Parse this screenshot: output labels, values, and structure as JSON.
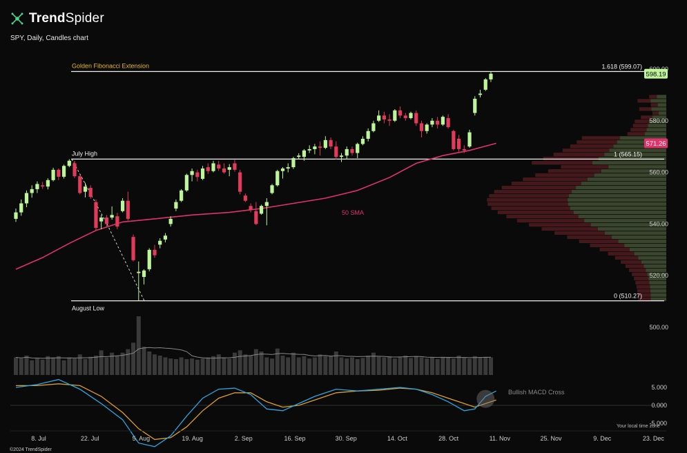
{
  "brand": {
    "name_bold": "Trend",
    "name_rest": "Spider"
  },
  "subtitle": "SPY, Daily, Candles chart",
  "copyright": "©2024 TrendSpider",
  "timezone_label": "Your local time zone",
  "colors": {
    "bg": "#0a0a0a",
    "up": "#bff59a",
    "down": "#e23a5a",
    "sma": "#e0336b",
    "macd": "#2aa8e6",
    "signal": "#e0a02a",
    "fib_label": "#e8b92c",
    "volume": "#3a3a3a"
  },
  "chart_data": {
    "type": "candlestick",
    "symbol": "SPY",
    "interval": "Daily",
    "price_axis": {
      "ticks": [
        "600.00",
        "580.00",
        "560.00",
        "540.00",
        "520.00",
        "500.00"
      ]
    },
    "x_axis": {
      "ticks": [
        "8. Jul",
        "22. Jul",
        "5. Aug",
        "19. Aug",
        "2. Sep",
        "16. Sep",
        "30. Sep",
        "14. Oct",
        "28. Oct",
        "11. Nov",
        "25. Nov",
        "9. Dec",
        "23. Dec"
      ]
    },
    "last_price": "598.19",
    "sma_value": "571.26",
    "sma_label": "50 SMA",
    "levels": [
      {
        "name": "Golden Fibonacci Extension",
        "value": 599.07,
        "tag": "1.618 (599.07)"
      },
      {
        "name": "July High",
        "value": 565.15,
        "tag": "1 (565.15)"
      },
      {
        "name": "August Low",
        "value": 510.27,
        "tag": "0 (510.27)"
      }
    ],
    "candles": [
      [
        542.0,
        546.0,
        540.8,
        544.5
      ],
      [
        544.5,
        549.5,
        543.2,
        548.0
      ],
      [
        548.0,
        553.0,
        546.5,
        552.0
      ],
      [
        552.0,
        555.0,
        550.2,
        553.5
      ],
      [
        553.5,
        556.5,
        552.0,
        555.5
      ],
      [
        555.0,
        556.3,
        553.6,
        554.5
      ],
      [
        554.5,
        557.7,
        553.4,
        557.0
      ],
      [
        557.0,
        561.8,
        556.5,
        561.0
      ],
      [
        561.0,
        561.5,
        557.0,
        558.3
      ],
      [
        558.3,
        563.0,
        557.6,
        562.5
      ],
      [
        562.5,
        565.1,
        562.0,
        564.5
      ],
      [
        563.5,
        564.5,
        557.8,
        558.5
      ],
      [
        558.5,
        559.0,
        551.5,
        552.0
      ],
      [
        552.5,
        556.0,
        550.3,
        554.5
      ],
      [
        554.0,
        555.0,
        549.8,
        550.5
      ],
      [
        548.5,
        549.5,
        537.5,
        538.5
      ],
      [
        541.0,
        543.5,
        538.0,
        542.5
      ],
      [
        542.5,
        543.5,
        538.6,
        540.0
      ],
      [
        542.5,
        546.8,
        541.7,
        543.5
      ],
      [
        543.0,
        544.3,
        538.0,
        539.0
      ],
      [
        545.0,
        550.0,
        544.5,
        549.0
      ],
      [
        549.0,
        552.5,
        541.3,
        542.0
      ],
      [
        535.0,
        536.0,
        525.5,
        526.0
      ],
      [
        521.0,
        525.5,
        510.3,
        521.5
      ],
      [
        519.5,
        522.5,
        516.6,
        522.0
      ],
      [
        522.5,
        530.6,
        521.7,
        530.0
      ],
      [
        530.0,
        531.9,
        526.9,
        527.9
      ],
      [
        532.0,
        534.5,
        530.6,
        533.5
      ],
      [
        534.0,
        536.5,
        532.9,
        535.5
      ],
      [
        540.0,
        543.0,
        539.0,
        542.0
      ],
      [
        546.0,
        549.5,
        545.0,
        548.5
      ],
      [
        549.0,
        553.5,
        548.5,
        553.0
      ],
      [
        553.0,
        559.5,
        552.5,
        559.0
      ],
      [
        559.0,
        561.5,
        556.5,
        560.5
      ],
      [
        560.0,
        561.0,
        556.5,
        558.2
      ],
      [
        557.5,
        562.5,
        557.0,
        561.5
      ],
      [
        562.0,
        563.5,
        559.4,
        560.5
      ],
      [
        560.5,
        564.5,
        560.0,
        563.5
      ],
      [
        563.0,
        564.5,
        560.6,
        561.5
      ],
      [
        561.5,
        563.5,
        559.5,
        560.0
      ],
      [
        561.0,
        563.2,
        558.5,
        562.0
      ],
      [
        563.5,
        564.8,
        560.3,
        561.0
      ],
      [
        560.0,
        561.0,
        551.5,
        552.5
      ],
      [
        551.0,
        551.8,
        548.5,
        549.0
      ],
      [
        547.0,
        548.0,
        544.5,
        545.5
      ],
      [
        545.0,
        548.5,
        539.6,
        540.0
      ],
      [
        544.0,
        547.5,
        543.6,
        547.0
      ],
      [
        547.0,
        550.0,
        539.5,
        548.5
      ],
      [
        552.0,
        555.5,
        551.5,
        555.0
      ],
      [
        555.0,
        561.0,
        554.5,
        560.5
      ],
      [
        560.5,
        562.0,
        557.6,
        561.5
      ],
      [
        561.5,
        563.5,
        560.0,
        562.0
      ],
      [
        562.0,
        566.0,
        561.3,
        565.5
      ],
      [
        566.0,
        567.4,
        565.0,
        566.5
      ],
      [
        566.0,
        569.0,
        564.5,
        568.5
      ],
      [
        568.5,
        570.5,
        567.5,
        569.0
      ],
      [
        569.0,
        571.0,
        567.0,
        570.0
      ],
      [
        570.0,
        572.0,
        566.5,
        569.5
      ],
      [
        569.5,
        574.0,
        569.0,
        572.5
      ],
      [
        572.5,
        573.5,
        569.0,
        570.0
      ],
      [
        570.0,
        572.0,
        565.0,
        566.0
      ],
      [
        566.0,
        567.5,
        564.0,
        566.5
      ],
      [
        566.5,
        570.0,
        565.0,
        569.0
      ],
      [
        569.0,
        570.0,
        566.5,
        567.5
      ],
      [
        567.5,
        571.5,
        565.5,
        571.0
      ],
      [
        571.0,
        574.0,
        570.5,
        573.0
      ],
      [
        573.0,
        577.0,
        572.0,
        576.0
      ],
      [
        576.0,
        580.0,
        575.5,
        579.0
      ],
      [
        580.0,
        584.0,
        579.5,
        582.0
      ],
      [
        582.0,
        583.5,
        579.0,
        580.5
      ],
      [
        580.5,
        582.5,
        578.0,
        580.0
      ],
      [
        580.0,
        584.5,
        579.5,
        584.0
      ],
      [
        584.0,
        585.5,
        581.0,
        582.0
      ],
      [
        582.0,
        583.0,
        580.0,
        581.0
      ],
      [
        581.0,
        583.5,
        580.5,
        583.0
      ],
      [
        583.0,
        584.0,
        578.0,
        579.0
      ],
      [
        579.0,
        580.0,
        573.5,
        576.0
      ],
      [
        576.0,
        579.0,
        575.0,
        578.5
      ],
      [
        578.5,
        581.0,
        577.5,
        580.0
      ],
      [
        580.0,
        581.5,
        577.0,
        578.5
      ],
      [
        578.5,
        582.0,
        578.0,
        581.5
      ],
      [
        581.0,
        582.5,
        577.0,
        577.5
      ],
      [
        576.0,
        576.5,
        568.5,
        569.0
      ],
      [
        573.0,
        574.5,
        568.0,
        569.0
      ],
      [
        569.0,
        570.5,
        567.5,
        568.5
      ],
      [
        570.0,
        576.5,
        569.5,
        575.5
      ],
      [
        583.0,
        589.5,
        582.0,
        588.5
      ],
      [
        590.0,
        592.0,
        589.0,
        590.5
      ],
      [
        592.0,
        596.5,
        591.5,
        596.0
      ],
      [
        596.0,
        599.1,
        595.0,
        598.2
      ]
    ],
    "sma": [
      [
        0,
        522.5
      ],
      [
        5,
        527.0
      ],
      [
        10,
        532.5
      ],
      [
        15,
        537.5
      ],
      [
        20,
        540.8
      ],
      [
        26,
        542.0
      ],
      [
        33,
        543.5
      ],
      [
        40,
        544.5
      ],
      [
        46,
        546.0
      ],
      [
        52,
        548.0
      ],
      [
        58,
        550.0
      ],
      [
        64,
        553.0
      ],
      [
        70,
        558.0
      ],
      [
        75,
        563.5
      ],
      [
        80,
        566.5
      ],
      [
        85,
        568.5
      ],
      [
        90,
        571.26
      ]
    ],
    "volume": [
      0.3,
      0.28,
      0.33,
      0.25,
      0.28,
      0.26,
      0.32,
      0.3,
      0.32,
      0.25,
      0.3,
      0.28,
      0.35,
      0.27,
      0.31,
      0.33,
      0.42,
      0.3,
      0.38,
      0.33,
      0.38,
      0.44,
      0.55,
      1.0,
      0.48,
      0.4,
      0.35,
      0.33,
      0.3,
      0.28,
      0.27,
      0.3,
      0.27,
      0.28,
      0.26,
      0.28,
      0.3,
      0.32,
      0.35,
      0.3,
      0.28,
      0.38,
      0.42,
      0.35,
      0.33,
      0.44,
      0.4,
      0.3,
      0.28,
      0.45,
      0.33,
      0.3,
      0.38,
      0.3,
      0.32,
      0.28,
      0.3,
      0.35,
      0.32,
      0.33,
      0.4,
      0.3,
      0.28,
      0.3,
      0.27,
      0.29,
      0.33,
      0.38,
      0.31,
      0.3,
      0.32,
      0.28,
      0.3,
      0.33,
      0.29,
      0.32,
      0.3,
      0.28,
      0.3,
      0.27,
      0.31,
      0.3,
      0.28,
      0.33,
      0.3,
      0.28,
      0.32,
      0.3,
      0.31,
      0.3
    ],
    "macd_axis": {
      "ticks": [
        "5.000",
        "0.000",
        "-5.000"
      ]
    },
    "macd_label": "Bullish MACD Cross",
    "macd": [
      [
        0,
        5.0
      ],
      [
        4,
        5.8
      ],
      [
        8,
        7.2
      ],
      [
        12,
        4.5
      ],
      [
        16,
        0.5
      ],
      [
        20,
        -4.0
      ],
      [
        23,
        -10.5
      ],
      [
        26,
        -11.5
      ],
      [
        29,
        -8.5
      ],
      [
        32,
        -3.0
      ],
      [
        35,
        2.0
      ],
      [
        38,
        4.5
      ],
      [
        41,
        4.8
      ],
      [
        44,
        3.0
      ],
      [
        47,
        -1.0
      ],
      [
        50,
        -1.5
      ],
      [
        53,
        0.5
      ],
      [
        56,
        2.5
      ],
      [
        60,
        4.5
      ],
      [
        64,
        4.0
      ],
      [
        68,
        4.5
      ],
      [
        72,
        5.0
      ],
      [
        75,
        4.5
      ],
      [
        78,
        3.0
      ],
      [
        81,
        1.0
      ],
      [
        84,
        -1.5
      ],
      [
        86,
        -1.0
      ],
      [
        88,
        2.5
      ],
      [
        90,
        4.0
      ]
    ],
    "signal": [
      [
        0,
        5.5
      ],
      [
        4,
        5.5
      ],
      [
        8,
        6.0
      ],
      [
        12,
        5.5
      ],
      [
        16,
        2.5
      ],
      [
        20,
        -2.0
      ],
      [
        23,
        -6.5
      ],
      [
        26,
        -9.5
      ],
      [
        29,
        -9.0
      ],
      [
        32,
        -6.0
      ],
      [
        35,
        -1.5
      ],
      [
        38,
        2.0
      ],
      [
        41,
        3.5
      ],
      [
        44,
        3.5
      ],
      [
        47,
        1.0
      ],
      [
        50,
        -0.5
      ],
      [
        53,
        0.0
      ],
      [
        56,
        1.5
      ],
      [
        60,
        3.5
      ],
      [
        64,
        4.0
      ],
      [
        68,
        4.2
      ],
      [
        72,
        4.8
      ],
      [
        75,
        4.5
      ],
      [
        78,
        3.5
      ],
      [
        81,
        2.0
      ],
      [
        84,
        0.5
      ],
      [
        86,
        -0.5
      ],
      [
        88,
        0.5
      ],
      [
        90,
        1.5
      ]
    ]
  }
}
